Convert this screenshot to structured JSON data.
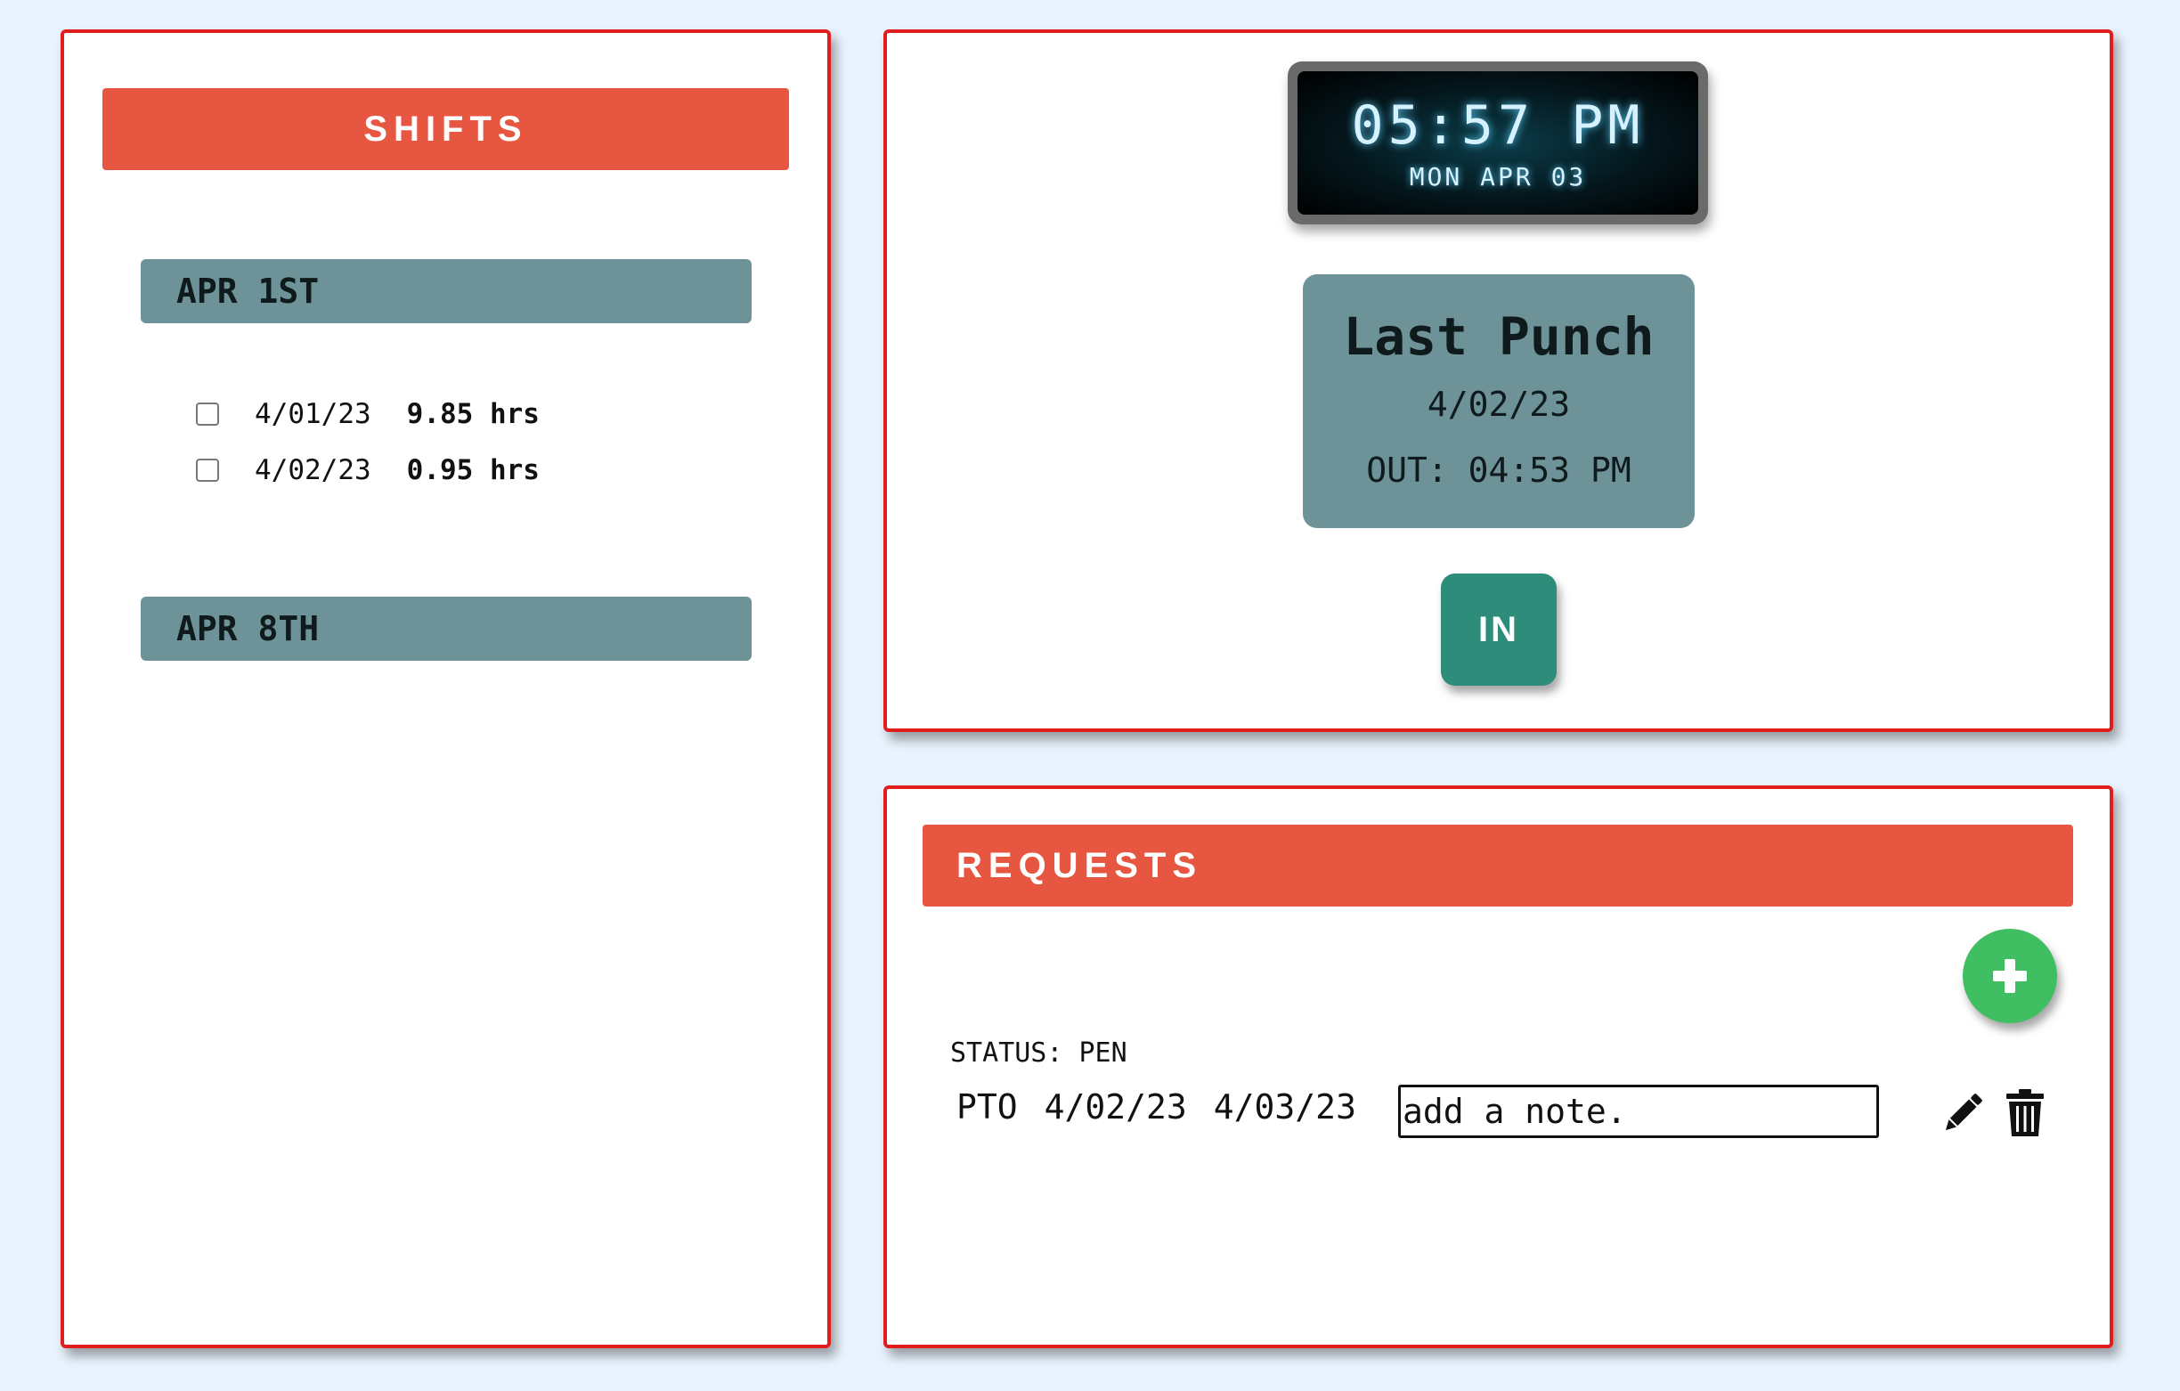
{
  "shifts": {
    "title": "SHIFTS",
    "weeks": [
      {
        "label": "APR 1ST",
        "entries": [
          {
            "date": "4/01/23",
            "hours": "9.85 hrs",
            "checked": false
          },
          {
            "date": "4/02/23",
            "hours": "0.95 hrs",
            "checked": false
          }
        ]
      },
      {
        "label": "APR 8TH",
        "entries": []
      }
    ]
  },
  "clock": {
    "time": "05:57 PM",
    "date": "MON APR 03"
  },
  "last_punch": {
    "title": "Last Punch",
    "date": "4/02/23",
    "out": "OUT: 04:53 PM"
  },
  "punch_button": {
    "label": "IN"
  },
  "requests": {
    "title": "REQUESTS",
    "add_icon": "plus-icon",
    "items": [
      {
        "status": "STATUS: PEN",
        "type": "PTO",
        "start": "4/02/23",
        "end": "4/03/23",
        "note_placeholder": "add a note.",
        "edit_icon": "pencil-icon",
        "delete_icon": "trash-icon"
      }
    ]
  },
  "colors": {
    "background": "#e9f3fd",
    "panel_border": "#e01e1e",
    "header": "#e65640",
    "slate": "#6d9399",
    "in_button": "#2d8c7a",
    "add_button": "#40bf62"
  }
}
